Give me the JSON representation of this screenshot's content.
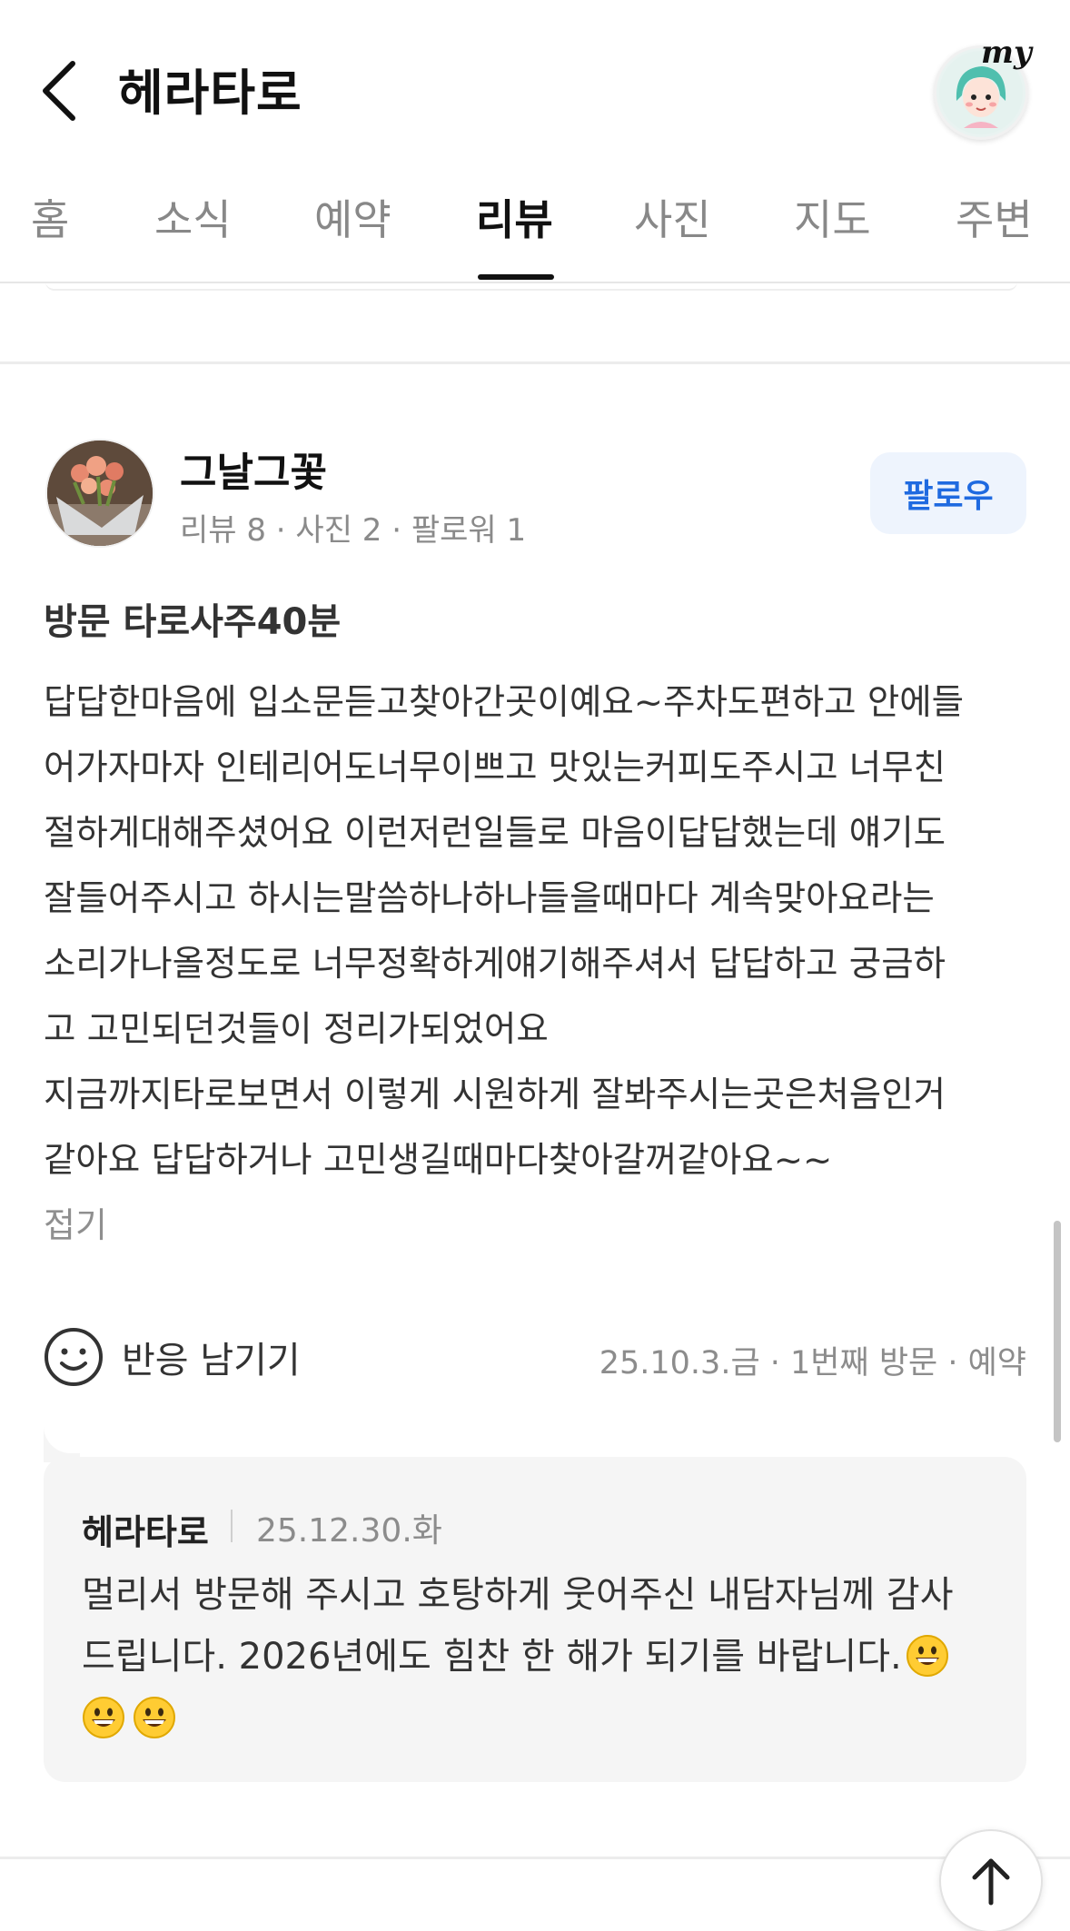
{
  "header": {
    "title": "헤라타로",
    "my_label": "my"
  },
  "tabs": [
    {
      "label": "홈"
    },
    {
      "label": "소식"
    },
    {
      "label": "예약"
    },
    {
      "label": "리뷰",
      "active": true
    },
    {
      "label": "사진"
    },
    {
      "label": "지도"
    },
    {
      "label": "주변"
    }
  ],
  "review": {
    "author": "그날그꽃",
    "stats": "리뷰 8 · 사진 2 · 팔로워 1",
    "follow_label": "팔로우",
    "visit_title": "방문 타로사주40분",
    "body_lines": [
      "답답한마음에 입소문듣고찾아간곳이예요~주차도편하고 안에들",
      "어가자마자 인테리어도너무이쁘고 맛있는커피도주시고 너무친",
      "절하게대해주셨어요 이런저런일들로 마음이답답했는데 얘기도",
      "잘들어주시고 하시는말씀하나하나들을때마다 계속맞아요라는",
      "소리가나올정도로 너무정확하게얘기해주셔서 답답하고 궁금하",
      "고 고민되던것들이 정리가되었어요",
      "지금까지타로보면서 이렇게 시원하게 잘봐주시는곳은처음인거",
      "같아요 답답하거나 고민생길때마다찾아갈꺼같아요~~"
    ],
    "fold_label": "접기",
    "reaction_label": "반응 남기기",
    "visit_meta": "25.10.3.금 · 1번째 방문 · 예약"
  },
  "reply": {
    "author": "헤라타로",
    "date": "25.12.30.화",
    "line1": "멀리서 방문해 주시고 호탕하게 웃어주신 내담자님께 감사",
    "line2": "드립니다. 2026년에도 힘찬 한 해가 되기를 바랍니다."
  },
  "colors": {
    "accent": "#1f6ae0",
    "follow_bg": "#eef4fd",
    "reply_bg": "#f5f5f5"
  },
  "icons": [
    "back-arrow-icon",
    "profile-character-icon",
    "smile-icon",
    "grinning-emoji-icon",
    "arrow-up-icon"
  ]
}
